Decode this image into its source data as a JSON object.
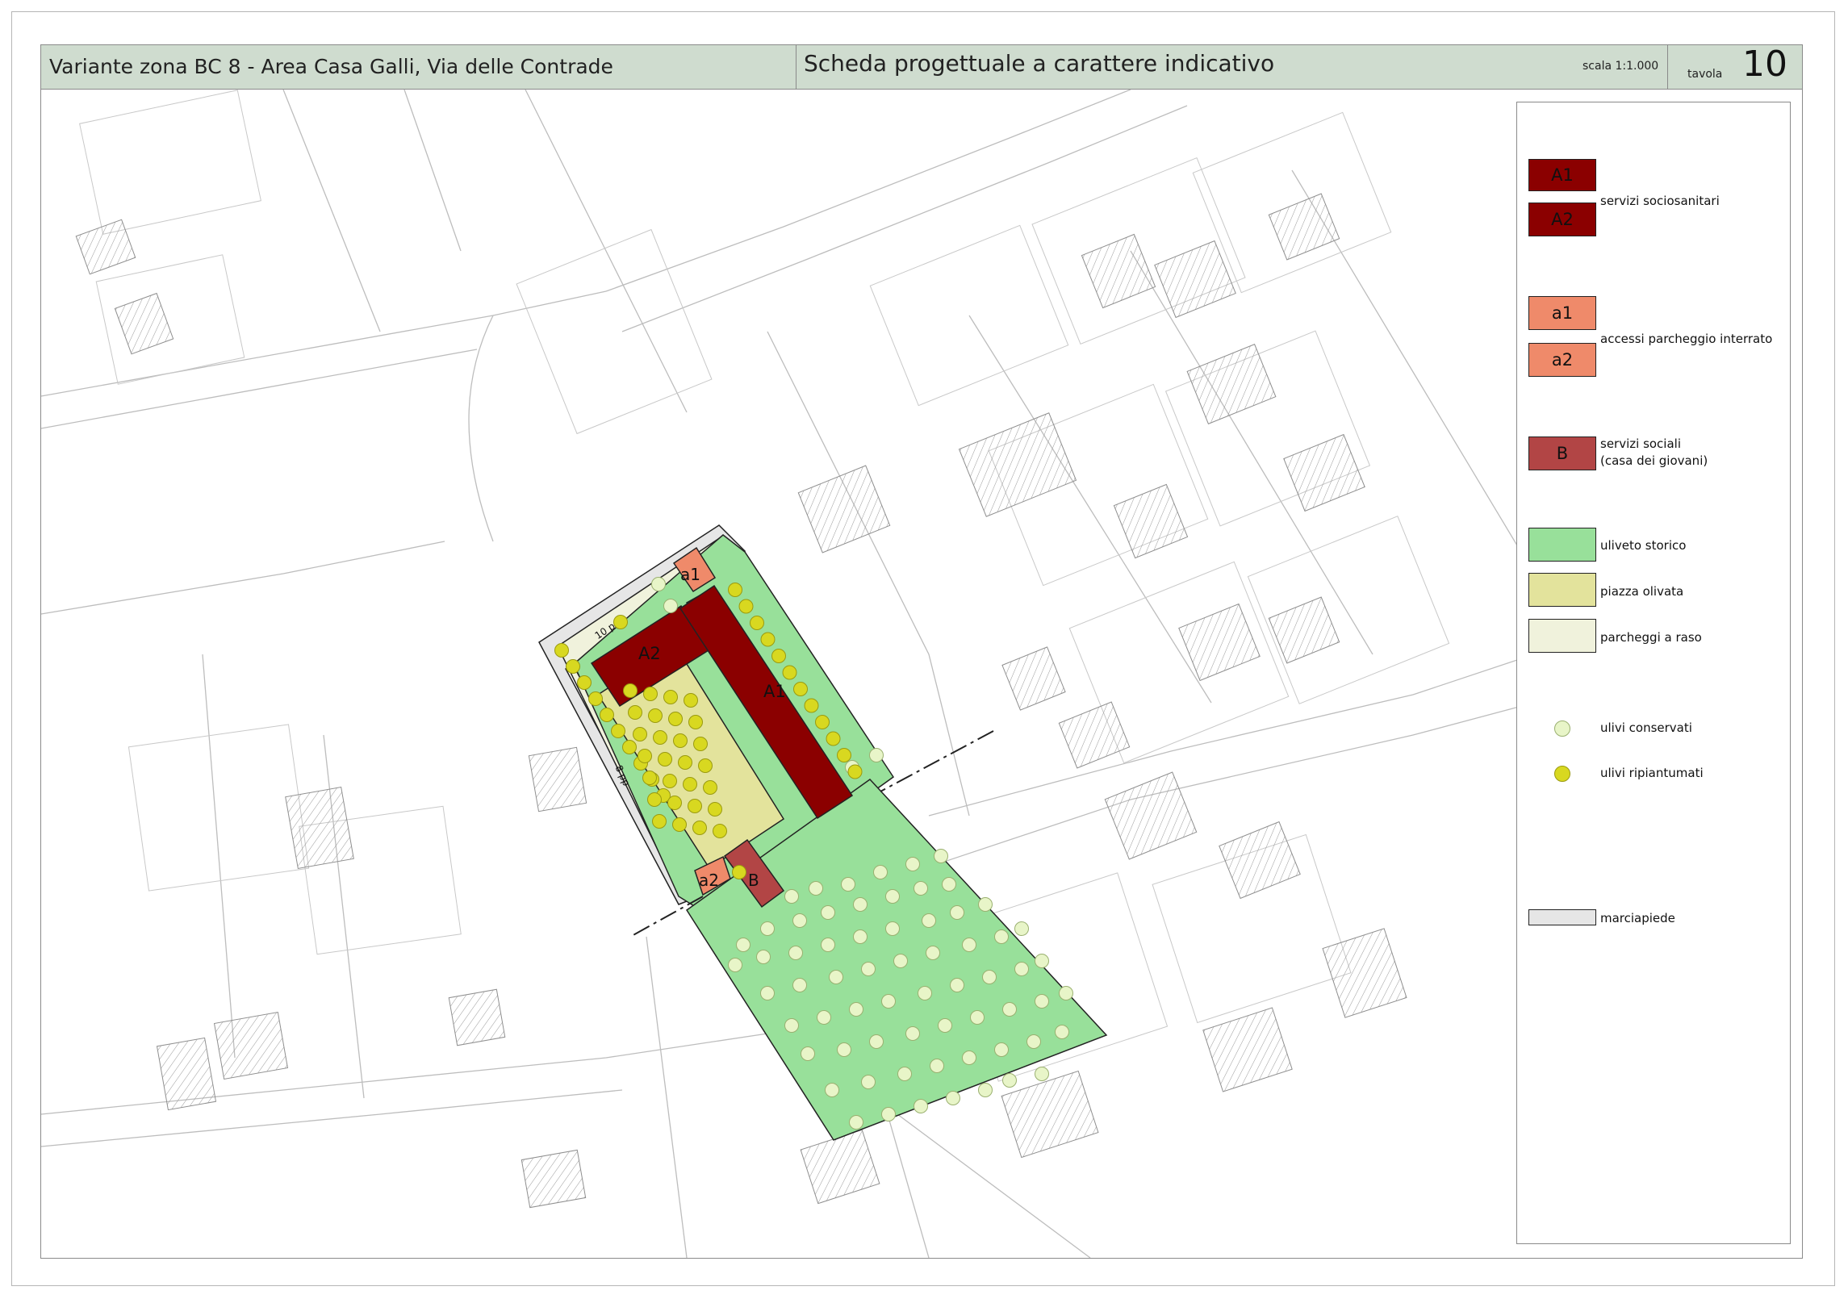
{
  "header": {
    "title": "Variante zona BC 8 - Area Casa Galli, Via delle Contrade",
    "subtitle": "Scheda progettuale a carattere indicativo",
    "scale": "scala 1:1.000",
    "tavola_label": "tavola",
    "tavola_number": "10"
  },
  "map_labels": {
    "a1": "a1",
    "a2": "a2",
    "A1": "A1",
    "A2": "A2",
    "B": "B",
    "parking_top": "10 pp",
    "parking_side": "8 pp"
  },
  "legend": {
    "items": [
      {
        "code": "A1",
        "color": "#8b0000"
      },
      {
        "code": "A2",
        "color": "#8b0000"
      },
      {
        "code": "a1",
        "color": "#ef8a6a"
      },
      {
        "code": "a2",
        "color": "#ef8a6a"
      },
      {
        "code": "B",
        "color": "#b24545"
      }
    ],
    "servizi_sociosanitari": "servizi sociosanitari",
    "accessi_parcheggio": "accessi parcheggio interrato",
    "servizi_sociali": "servizi sociali",
    "casa_giovani": "(casa dei giovani)",
    "uliveto_storico": "uliveto storico",
    "piazza_olivata": "piazza  olivata",
    "parcheggi_raso": "parcheggi a raso",
    "ulivi_conservati": "ulivi conservati",
    "ulivi_ripiantumati": "ulivi ripiantumati",
    "marciapiede": "marciapiede",
    "colors": {
      "uliveto": "#98e09a",
      "piazza": "#e3e39c",
      "parcheggi": "#f0f2dc",
      "ulivi_conservati": "#e8f5c8",
      "ulivi_ripiantumati": "#d8d820",
      "marciapiede": "#e6e6e6"
    }
  }
}
